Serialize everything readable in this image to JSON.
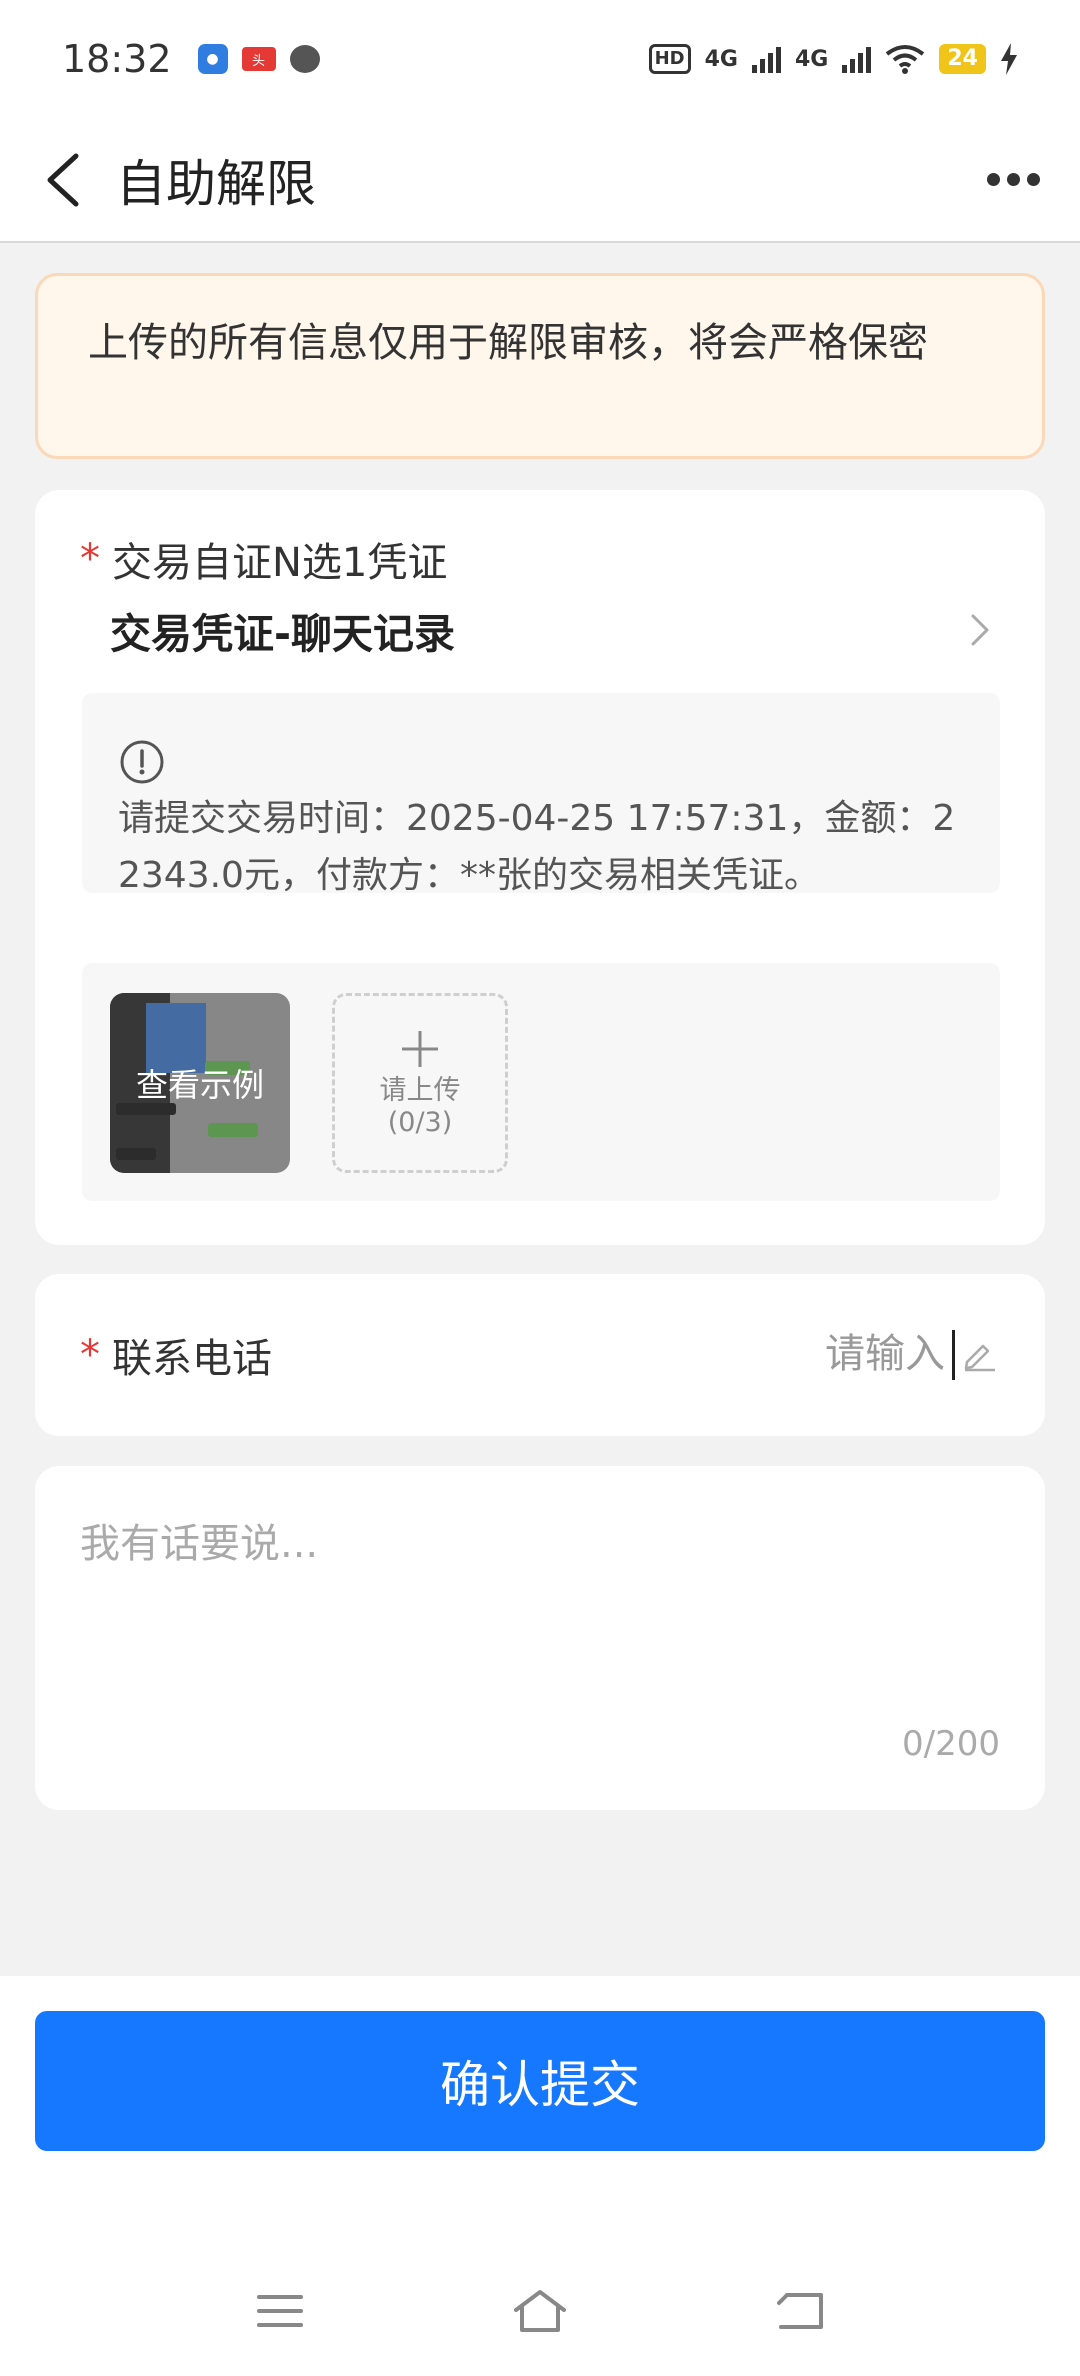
{
  "status_bar": {
    "time": "18:32",
    "icons": [
      "app-blue-icon",
      "toutiao-icon",
      "chat-bubble-icon"
    ],
    "hd": "HD",
    "net1": "4G",
    "net2": "4G",
    "battery": "24"
  },
  "header": {
    "title": "自助解限"
  },
  "notice": {
    "text": "上传的所有信息仅用于解限审核，将会严格保密"
  },
  "voucher": {
    "label": "交易自证N选1凭证",
    "selected": "交易凭证-聊天记录",
    "hint": "请提交交易时间：2025-04-25 17:57:31，金额：22343.0元，付款方：**张的交易相关凭证。",
    "example_label": "查看示例",
    "upload_label": "请上传",
    "upload_count": "(0/3)"
  },
  "phone": {
    "label": "联系电话",
    "placeholder": "请输入",
    "value": ""
  },
  "comment": {
    "placeholder": "我有话要说...",
    "counter": "0/200"
  },
  "submit": {
    "label": "确认提交"
  },
  "colors": {
    "primary": "#1677ff",
    "required": "#e53935",
    "notice_bg": "#fff6ec",
    "notice_border": "#fbd9b8"
  }
}
